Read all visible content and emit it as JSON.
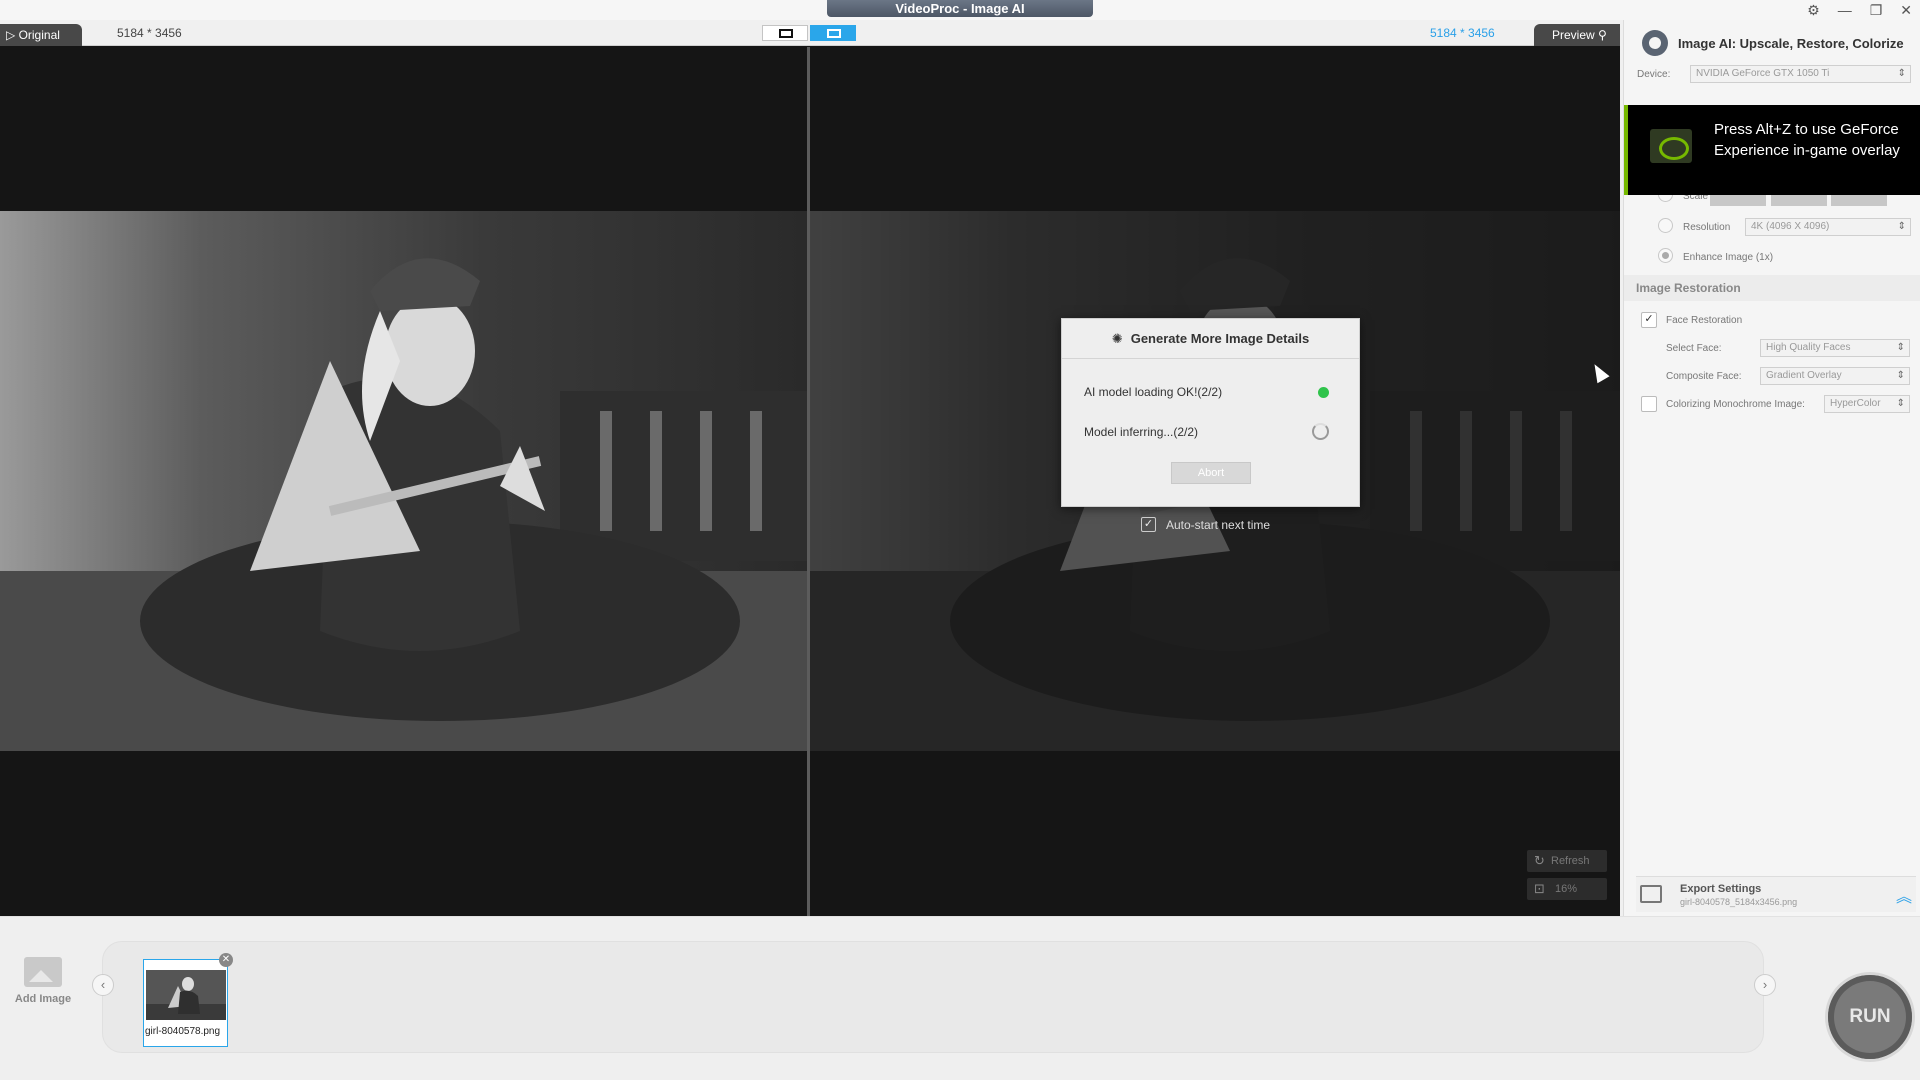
{
  "window": {
    "title": "VideoProc - Image AI"
  },
  "viewer": {
    "tab_original": "Original",
    "tab_preview": "Preview",
    "dim_left": "5184 * 3456",
    "dim_right": "5184 * 3456",
    "refresh_label": "Refresh",
    "zoom_label": "16%"
  },
  "dialog": {
    "title": "Generate More Image Details",
    "row1": "AI model loading OK!(2/2)",
    "row2": "Model inferring...(2/2)",
    "abort_label": "Abort",
    "auto_start_label": "Auto-start next time",
    "auto_start_checked": true
  },
  "panel": {
    "title": "Image AI: Upscale, Restore, Colorize",
    "device_label": "Device:",
    "device_value": "NVIDIA GeForce GTX 1050 Ti",
    "scale_label": "Scale",
    "resolution_label": "Resolution",
    "resolution_value": "4K (4096 X 4096)",
    "enhance_label": "Enhance Image (1x)",
    "restoration_section": "Image Restoration",
    "face_restoration_label": "Face Restoration",
    "select_face_label": "Select Face:",
    "select_face_value": "High Quality Faces",
    "composite_face_label": "Composite Face:",
    "composite_face_value": "Gradient Overlay",
    "colorize_label": "Colorizing Monochrome Image:",
    "colorize_value": "HyperColor",
    "export_title": "Export Settings",
    "export_file": "girl-8040578_5184x3456.png"
  },
  "overlay": {
    "text": "Press Alt+Z to use GeForce Experience in-game overlay"
  },
  "bottom": {
    "add_image_label": "Add Image",
    "thumb_name": "girl-8040578.png",
    "run_label": "RUN"
  },
  "colors": {
    "accent": "#2aa6ea",
    "nvidia_green": "#76b900",
    "ok_green": "#2fc34b"
  }
}
